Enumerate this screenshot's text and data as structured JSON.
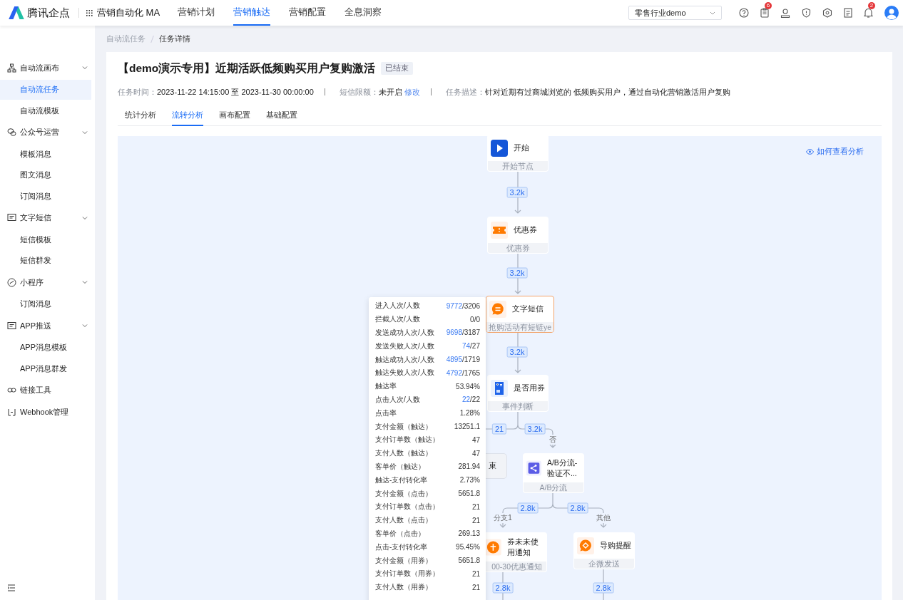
{
  "app": {
    "logo": "腾讯企点",
    "product": "营销自动化 MA"
  },
  "nav_tabs": [
    {
      "label": "营销计划",
      "selected": false
    },
    {
      "label": "营销触达",
      "selected": true
    },
    {
      "label": "营销配置",
      "selected": false
    },
    {
      "label": "全息洞察",
      "selected": false
    }
  ],
  "account_select": {
    "value": "零售行业demo"
  },
  "header_badges": [
    "6",
    "2"
  ],
  "sidebar": {
    "groups": [
      {
        "label": "自动流画布",
        "expanded": true,
        "children": [
          {
            "label": "自动流任务",
            "selected": true
          },
          {
            "label": "自动流模板",
            "selected": false
          }
        ]
      },
      {
        "label": "公众号运营",
        "expanded": true,
        "children": [
          {
            "label": "模板消息",
            "selected": false
          },
          {
            "label": "图文消息",
            "selected": false
          },
          {
            "label": "订阅消息",
            "selected": false
          }
        ]
      },
      {
        "label": "文字短信",
        "expanded": true,
        "children": [
          {
            "label": "短信模板",
            "selected": false
          },
          {
            "label": "短信群发",
            "selected": false
          }
        ]
      },
      {
        "label": "小程序",
        "expanded": true,
        "children": [
          {
            "label": "订阅消息",
            "selected": false
          }
        ]
      },
      {
        "label": "APP推送",
        "expanded": true,
        "children": [
          {
            "label": "APP消息模板",
            "selected": false
          },
          {
            "label": "APP消息群发",
            "selected": false
          }
        ]
      },
      {
        "label": "链接工具"
      },
      {
        "label": "Webhook管理"
      }
    ]
  },
  "breadcrumb": [
    "自动流任务",
    "任务详情"
  ],
  "task": {
    "title": "【demo演示专用】近期活跃低频购买用户复购激活",
    "status": "已结束",
    "fields": [
      {
        "label": "任务时间：",
        "value": "2023-11-22 14:15:00 至 2023-11-30 00:00:00"
      },
      {
        "label": "短信限额：",
        "value": "未开启",
        "link": "修改"
      },
      {
        "label": "任务描述：",
        "value": "针对近期有过商城浏览的 低频购买用户，通过自动化营销激活用户复购"
      }
    ]
  },
  "page_tabs": [
    {
      "label": "统计分析",
      "selected": false
    },
    {
      "label": "流转分析",
      "selected": true
    },
    {
      "label": "画布配置",
      "selected": false
    },
    {
      "label": "基础配置",
      "selected": false
    }
  ],
  "flow": {
    "help_link": "如何查看分析",
    "nodes": [
      {
        "kind": "start",
        "title": "开始",
        "subtitle": "开始节点",
        "selected": false
      },
      {
        "kind": "coupon",
        "title": "优惠券",
        "subtitle": "优惠券",
        "selected": false
      },
      {
        "kind": "sms",
        "title": "文字短信",
        "subtitle": "抢购活动有短链ye",
        "selected": true
      },
      {
        "kind": "condition",
        "title": "是否用券",
        "subtitle": "事件判断",
        "selected": false
      },
      {
        "kind": "end",
        "title": "束",
        "selected": false
      },
      {
        "kind": "ab",
        "title": "A/B分流-验证不...",
        "subtitle": "A/B分流",
        "selected": false
      },
      {
        "kind": "notice",
        "title": "券未未使用通知",
        "subtitle": "00-30优惠通知",
        "selected": false
      },
      {
        "kind": "wecom",
        "title": "导购提醒",
        "subtitle": "企微发送",
        "selected": false
      }
    ],
    "edge_labels": [
      "3.2k",
      "3.2k",
      "3.2k",
      "21",
      "3.2k",
      "2.8k",
      "2.8k",
      "2.8k",
      "2.8k"
    ],
    "branch_labels": [
      "否",
      "分支1",
      "其他"
    ],
    "tooltip": {
      "rows": [
        {
          "label": "进入人次/人数",
          "link": "9772",
          "value": "/3206"
        },
        {
          "label": "拦截人次/人数",
          "value": "0/0"
        },
        {
          "label": "发送成功人次/人数",
          "link": "9698",
          "value": "/3187"
        },
        {
          "label": "发送失败人次/人数",
          "link": "74",
          "value": "/27"
        },
        {
          "label": "触达成功人次/人数",
          "link": "4895",
          "value": "/1719"
        },
        {
          "label": "触达失败人次/人数",
          "link": "4792",
          "value": "/1765"
        },
        {
          "label": "触达率",
          "value": "53.94%"
        },
        {
          "label": "点击人次/人数",
          "link": "22",
          "value": "/22"
        },
        {
          "label": "点击率",
          "value": "1.28%"
        },
        {
          "label": "支付金额（触达）",
          "value": "13251.1"
        },
        {
          "label": "支付订单数（触达）",
          "value": "47"
        },
        {
          "label": "支付人数（触达）",
          "value": "47"
        },
        {
          "label": "客单价（触达）",
          "value": "281.94"
        },
        {
          "label": "触达-支付转化率",
          "value": "2.73%"
        },
        {
          "label": "支付金额（点击）",
          "value": "5651.8"
        },
        {
          "label": "支付订单数（点击）",
          "value": "21"
        },
        {
          "label": "支付人数（点击）",
          "value": "21"
        },
        {
          "label": "客单价（点击）",
          "value": "269.13"
        },
        {
          "label": "点击-支付转化率",
          "value": "95.45%"
        },
        {
          "label": "支付金额（用券）",
          "value": "5651.8"
        },
        {
          "label": "支付订单数（用券）",
          "value": "21"
        },
        {
          "label": "支付人数（用券）",
          "value": "21"
        }
      ]
    }
  }
}
